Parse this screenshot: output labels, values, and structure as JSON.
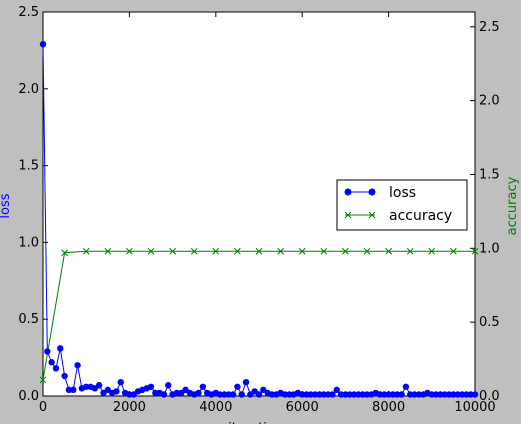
{
  "chart_data": {
    "type": "line",
    "xlabel": "iterations",
    "ylabel_left": "loss",
    "ylabel_right": "accuracy",
    "xlim": [
      0,
      10000
    ],
    "ylim_left": [
      0,
      2.5
    ],
    "ylim_right": [
      0,
      2.6
    ],
    "x_ticks": [
      0,
      2000,
      4000,
      6000,
      8000,
      10000
    ],
    "y_ticks_left": [
      0.0,
      0.5,
      1.0,
      1.5,
      2.0,
      2.5
    ],
    "y_ticks_right": [
      0.0,
      0.5,
      1.0,
      1.5,
      2.0,
      2.5
    ],
    "grid": false,
    "legend_position": "center-right",
    "series": [
      {
        "name": "loss",
        "axis": "left",
        "color": "#0000ff",
        "marker": "circle",
        "x": [
          0,
          100,
          200,
          300,
          400,
          500,
          600,
          700,
          800,
          900,
          1000,
          1100,
          1200,
          1300,
          1400,
          1500,
          1600,
          1700,
          1800,
          1900,
          2000,
          2100,
          2200,
          2300,
          2400,
          2500,
          2600,
          2700,
          2800,
          2900,
          3000,
          3100,
          3200,
          3300,
          3400,
          3500,
          3600,
          3700,
          3800,
          3900,
          4000,
          4100,
          4200,
          4300,
          4400,
          4500,
          4600,
          4700,
          4800,
          4900,
          5000,
          5100,
          5200,
          5300,
          5400,
          5500,
          5600,
          5700,
          5800,
          5900,
          6000,
          6100,
          6200,
          6300,
          6400,
          6500,
          6600,
          6700,
          6800,
          6900,
          7000,
          7100,
          7200,
          7300,
          7400,
          7500,
          7600,
          7700,
          7800,
          7900,
          8000,
          8100,
          8200,
          8300,
          8400,
          8500,
          8600,
          8700,
          8800,
          8900,
          9000,
          9100,
          9200,
          9300,
          9400,
          9500,
          9600,
          9700,
          9800,
          9900,
          10000
        ],
        "values": [
          2.29,
          0.29,
          0.22,
          0.18,
          0.31,
          0.13,
          0.04,
          0.04,
          0.2,
          0.05,
          0.06,
          0.06,
          0.05,
          0.07,
          0.02,
          0.04,
          0.02,
          0.03,
          0.09,
          0.02,
          0.01,
          0.01,
          0.03,
          0.04,
          0.05,
          0.06,
          0.02,
          0.02,
          0.01,
          0.07,
          0.01,
          0.02,
          0.02,
          0.04,
          0.02,
          0.01,
          0.02,
          0.06,
          0.02,
          0.01,
          0.02,
          0.01,
          0.01,
          0.01,
          0.01,
          0.06,
          0.01,
          0.09,
          0.01,
          0.03,
          0.01,
          0.04,
          0.02,
          0.01,
          0.01,
          0.02,
          0.01,
          0.01,
          0.01,
          0.02,
          0.01,
          0.01,
          0.01,
          0.01,
          0.01,
          0.01,
          0.01,
          0.01,
          0.04,
          0.01,
          0.01,
          0.01,
          0.01,
          0.01,
          0.01,
          0.01,
          0.01,
          0.02,
          0.01,
          0.01,
          0.01,
          0.01,
          0.01,
          0.01,
          0.06,
          0.01,
          0.01,
          0.01,
          0.01,
          0.02,
          0.01,
          0.01,
          0.01,
          0.01,
          0.01,
          0.01,
          0.01,
          0.01,
          0.01,
          0.01,
          0.01
        ]
      },
      {
        "name": "accuracy",
        "axis": "right",
        "color": "#008000",
        "marker": "x",
        "x": [
          0,
          500,
          1000,
          1500,
          2000,
          2500,
          3000,
          3500,
          4000,
          4500,
          5000,
          5500,
          6000,
          6500,
          7000,
          7500,
          8000,
          8500,
          9000,
          9500,
          10000
        ],
        "values": [
          0.11,
          0.97,
          0.98,
          0.98,
          0.98,
          0.98,
          0.98,
          0.98,
          0.98,
          0.98,
          0.98,
          0.98,
          0.98,
          0.98,
          0.98,
          0.98,
          0.98,
          0.98,
          0.98,
          0.98,
          0.98
        ]
      }
    ]
  }
}
